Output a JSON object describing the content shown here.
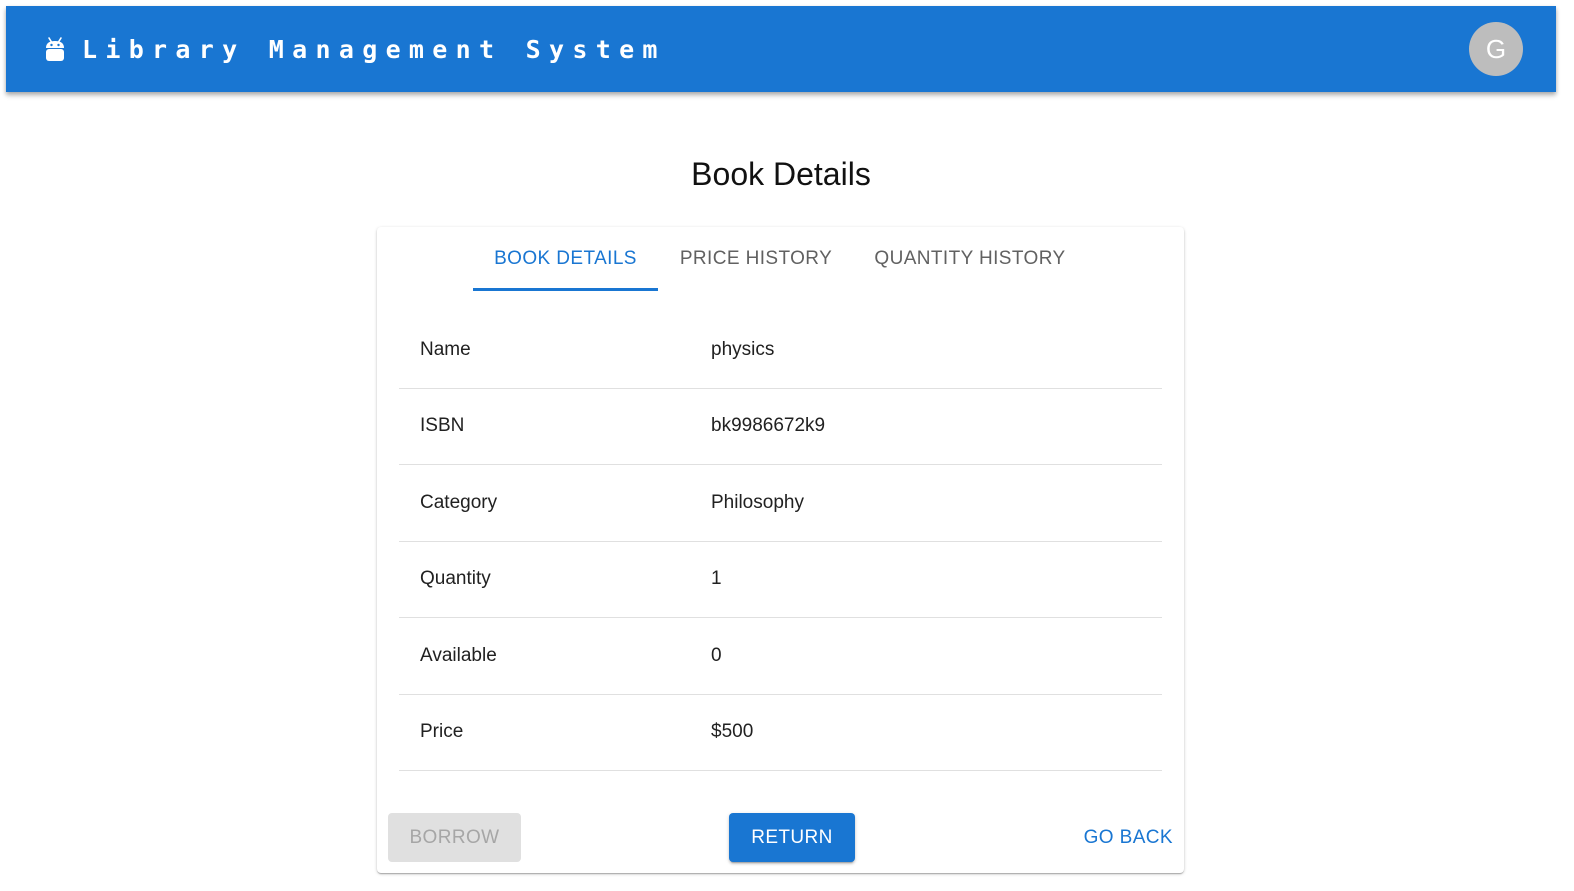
{
  "appbar": {
    "title": "Library Management System",
    "icon": "android-icon",
    "avatar_letter": "G",
    "color": "#1976d2"
  },
  "page": {
    "title": "Book Details"
  },
  "tabs": [
    {
      "label": "BOOK DETAILS",
      "active": true
    },
    {
      "label": "PRICE HISTORY",
      "active": false
    },
    {
      "label": "QUANTITY HISTORY",
      "active": false
    }
  ],
  "details": [
    {
      "label": "Name",
      "value": "physics"
    },
    {
      "label": "ISBN",
      "value": "bk9986672k9"
    },
    {
      "label": "Category",
      "value": "Philosophy"
    },
    {
      "label": "Quantity",
      "value": "1"
    },
    {
      "label": "Available",
      "value": "0"
    },
    {
      "label": "Price",
      "value": "$500"
    }
  ],
  "actions": {
    "borrow_label": "BORROW",
    "borrow_disabled": true,
    "return_label": "RETURN",
    "go_back_label": "GO BACK"
  },
  "colors": {
    "primary": "#1976d2",
    "disabled_bg": "#e0e0e0",
    "disabled_text": "#a6a6a6",
    "avatar_bg": "#bdbdbd"
  }
}
